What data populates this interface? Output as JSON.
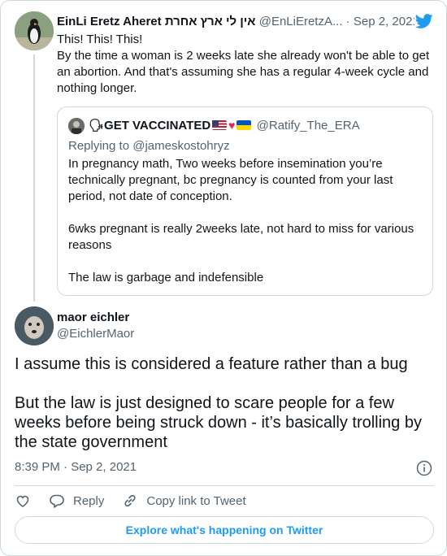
{
  "parent_tweet": {
    "author_name": "EinLi Eretz Aheret אין לי ארץ אחרת",
    "author_handle": "@EnLiEretzA...",
    "separator": "·",
    "date": "Sep 2, 2021",
    "text_lines": [
      "This! This! This!",
      "By the time a woman is 2 weeks late she already won't be able to get an abortion. And that's assuming she has a regular 4-week cycle and nothing longer."
    ],
    "avatar_icon": "penguin-avatar"
  },
  "quoted_tweet": {
    "author_name_prefix": "🗣GET VACCINATED",
    "author_handle": "@Ratify_The_ERA",
    "replying_to": "Replying to @jameskostohryz",
    "paragraphs": [
      "In pregnancy math, Two weeks before insemination you’re technically pregnant, bc pregnancy is counted from your last period, not date of conception.",
      "6wks pregnant is really 2weeks late, not hard to miss for various reasons",
      "The law is garbage and indefensible"
    ]
  },
  "main_tweet": {
    "author_name": "maor eichler",
    "author_handle": "@EichlerMaor",
    "paragraphs": [
      "I assume this is considered a feature rather than a bug",
      "But the law is just designed to scare people for a few weeks before being struck down - it’s basically trolling by the state government"
    ],
    "timestamp": "8:39 PM · Sep 2, 2021"
  },
  "actions": {
    "reply_label": "Reply",
    "copy_link_label": "Copy link to Tweet"
  },
  "explore_label": "Explore what's happening on Twitter",
  "colors": {
    "accent": "#1d9bf0",
    "muted": "#536471",
    "border": "#cfd9de"
  }
}
